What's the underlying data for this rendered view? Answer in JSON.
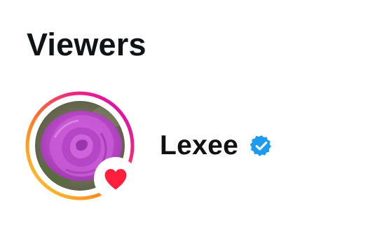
{
  "header": {
    "title": "Viewers"
  },
  "viewers": [
    {
      "username": "Lexee",
      "verified": true,
      "reaction_icon": "heart-icon",
      "avatar_icon": "rose-photo",
      "has_story_ring": true
    }
  ],
  "colors": {
    "ring_gradient": [
      "#feda75",
      "#fa7e1e",
      "#d62976",
      "#962fbf"
    ],
    "heart": "#ff1f3d",
    "verified": "#1d9bf0",
    "text": "#111111"
  }
}
